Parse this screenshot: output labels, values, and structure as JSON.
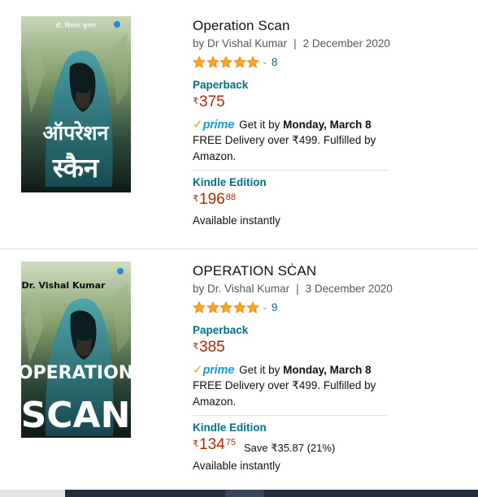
{
  "colors": {
    "link": "#007185",
    "price": "#b12704",
    "star": "#ffa41c",
    "prime_check": "#f0a41b",
    "prime_word": "#1a98d5",
    "muted": "#565959"
  },
  "results": [
    {
      "cover": {
        "author": "डॉ. विशाल कुमार",
        "title_line1": "ऑपरेशन",
        "title_line2": "स्कैन",
        "alt": "book-cover-hindi"
      },
      "title": "Operation Scan",
      "by_prefix": "by",
      "author": "Dr Vishal Kumar",
      "separator": "|",
      "date": "2 December 2020",
      "rating_stars": 5,
      "rating_icon": "chevron-down-icon",
      "rating_chevron": "⌄",
      "rating_count": "8",
      "paperback": {
        "label": "Paperback",
        "currency": "₹",
        "price_whole": "375"
      },
      "prime": {
        "check": "✓",
        "word": "prime",
        "get_it_by": "Get it by",
        "date": "Monday, March 8"
      },
      "delivery": "FREE Delivery over ₹499. Fulfilled by Amazon.",
      "kindle": {
        "label": "Kindle Edition",
        "currency": "₹",
        "price_whole": "196",
        "price_fraction": "88",
        "save": ""
      },
      "availability": "Available instantly"
    },
    {
      "cover": {
        "author": "Dr. Vishal Kumar",
        "title_line1": "OPERATION",
        "title_line2": "SCAN",
        "alt": "book-cover-english"
      },
      "title": "OPERATION SĊAN",
      "by_prefix": "by",
      "author": "Dr. Vishal Kumar",
      "separator": "|",
      "date": "3 December 2020",
      "rating_stars": 5,
      "rating_icon": "chevron-down-icon",
      "rating_chevron": "⌄",
      "rating_count": "9",
      "paperback": {
        "label": "Paperback",
        "currency": "₹",
        "price_whole": "385"
      },
      "prime": {
        "check": "✓",
        "word": "prime",
        "get_it_by": "Get it by",
        "date": "Monday, March 8"
      },
      "delivery": "FREE Delivery over ₹499. Fulfilled by Amazon.",
      "kindle": {
        "label": "Kindle Edition",
        "currency": "₹",
        "price_whole": "134",
        "price_fraction": "75",
        "save": "Save ₹35.87 (21%)"
      },
      "availability": "Available instantly"
    }
  ]
}
